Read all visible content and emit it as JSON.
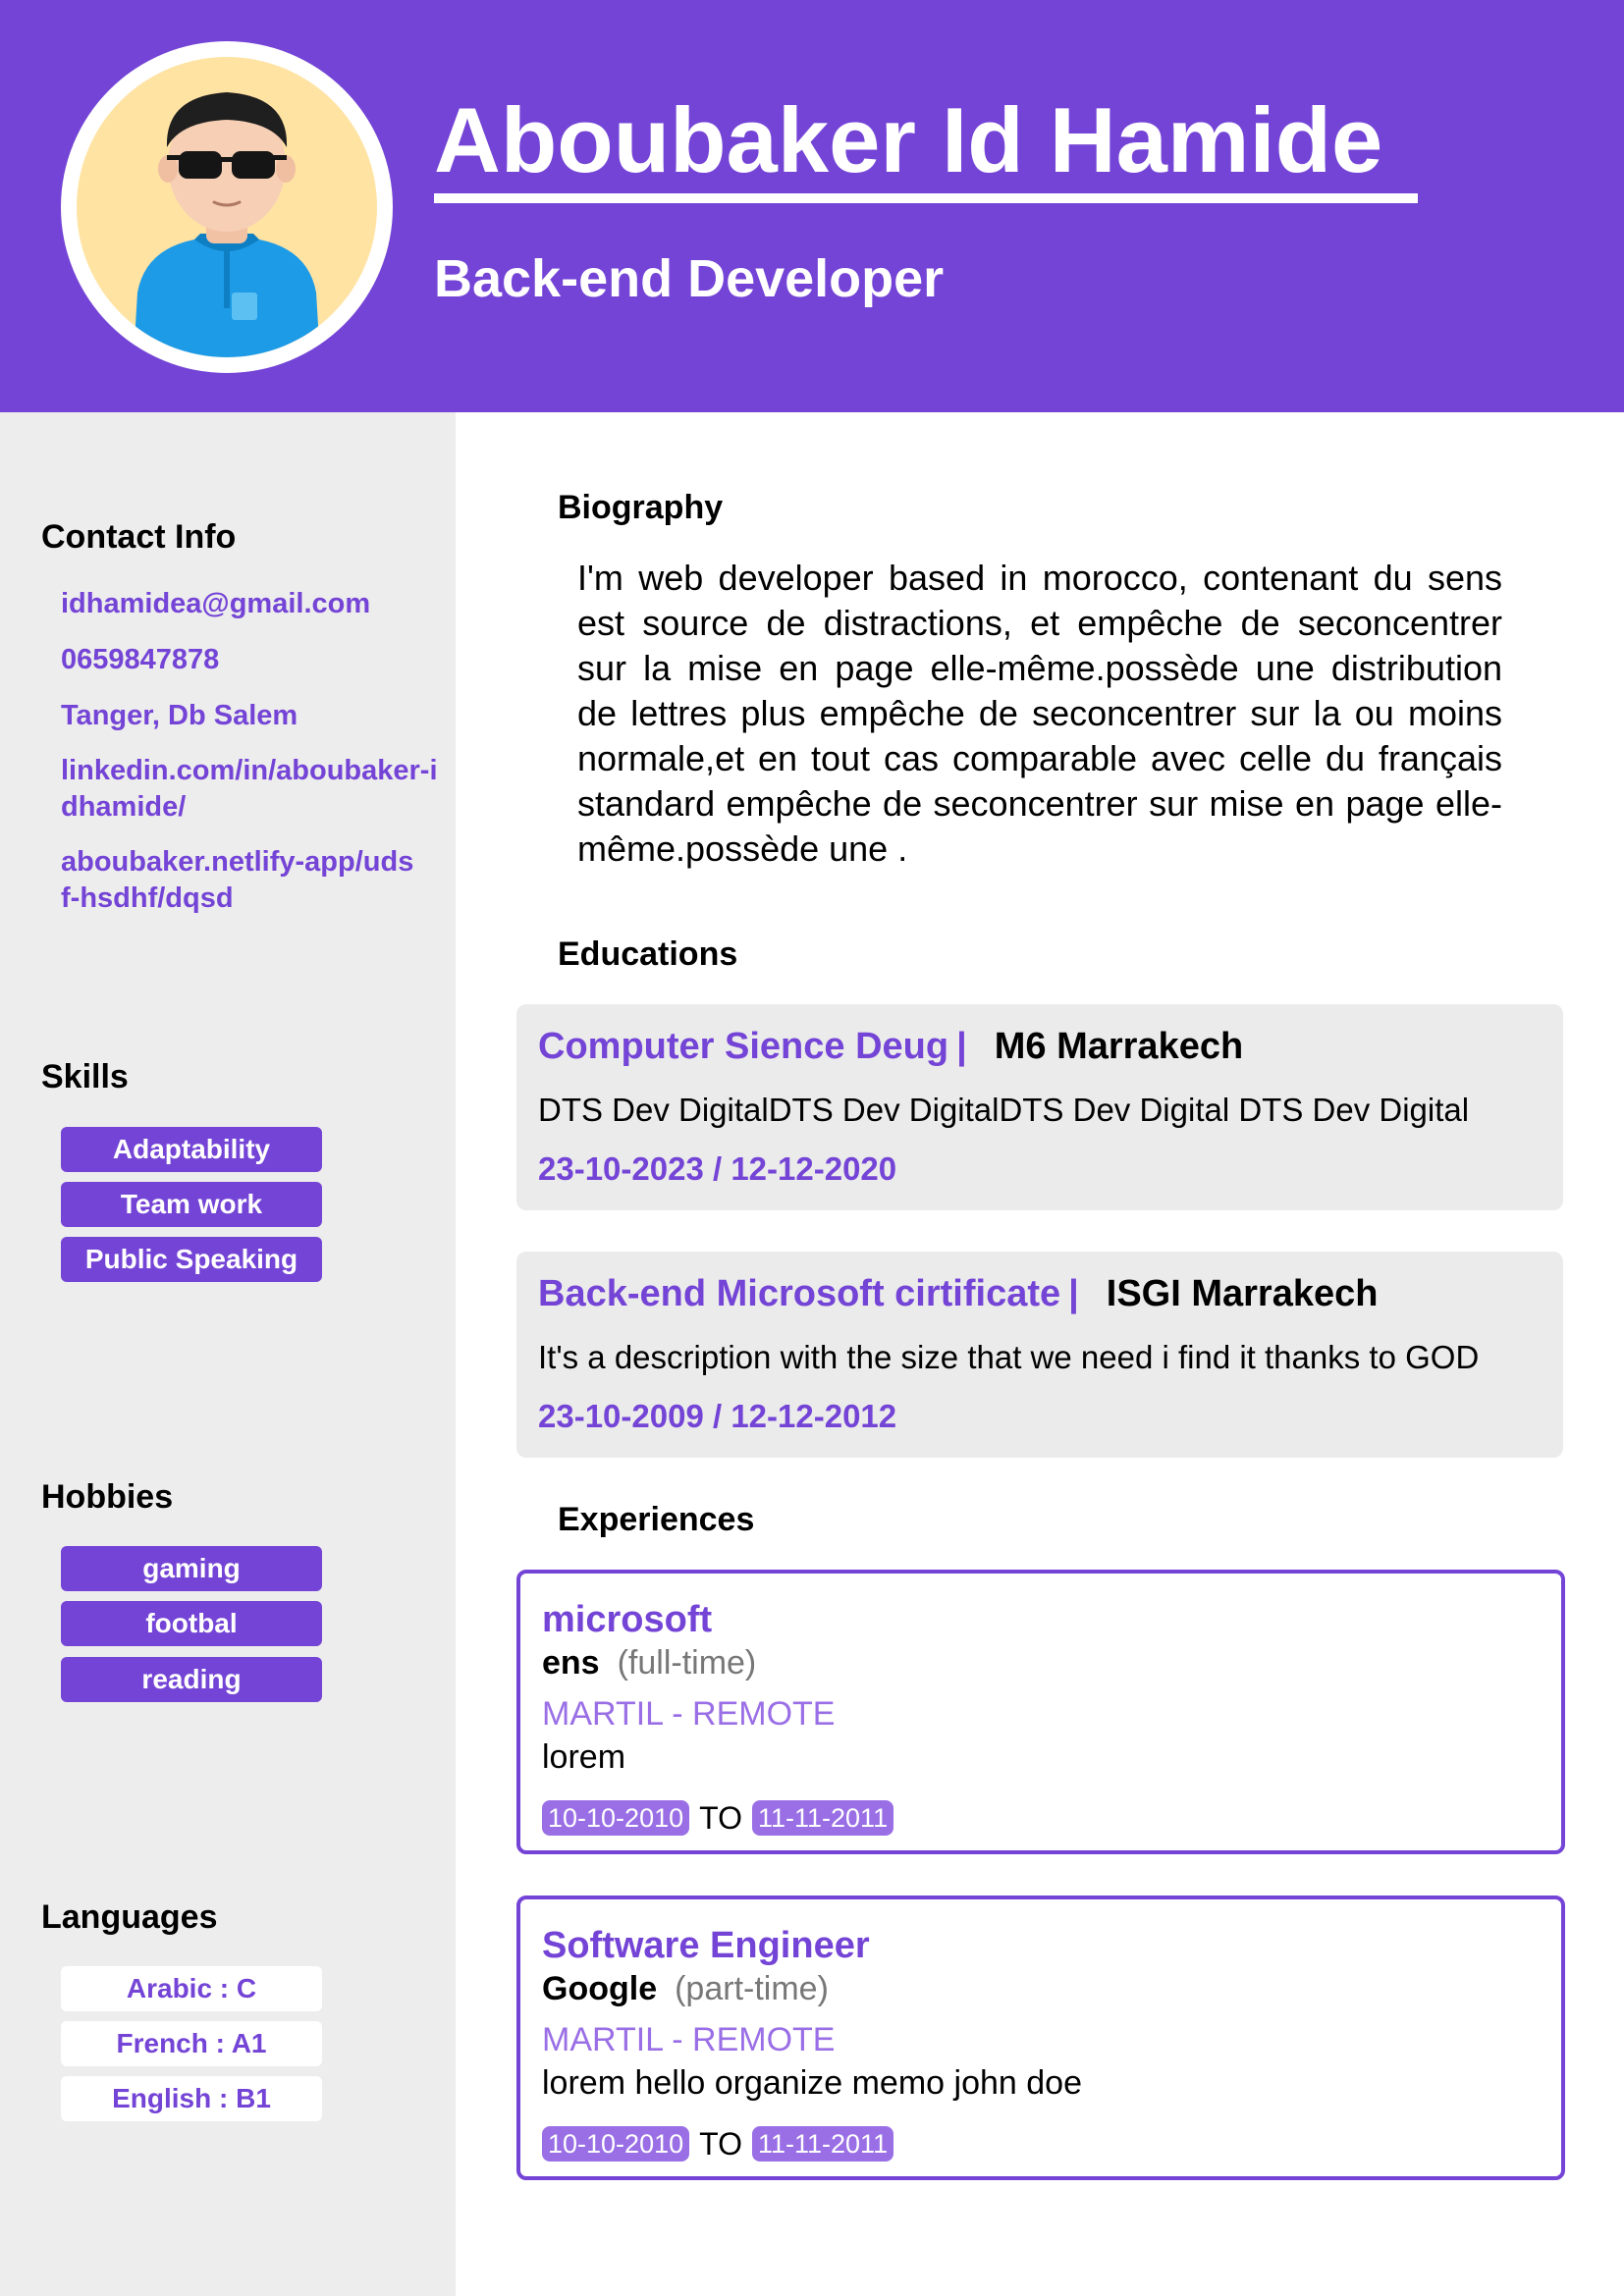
{
  "header": {
    "name": "Aboubaker Id Hamide",
    "job_title": "Back-end Developer",
    "avatar_icon": "avatar-3d-man-sunglasses-icon"
  },
  "sidebar": {
    "contact": {
      "heading": "Contact Info",
      "email": "idhamidea@gmail.com",
      "phone": "0659847878",
      "address": "Tanger, Db Salem",
      "linkedin": "linkedin.com/in/aboubaker-idhamide/",
      "website": "aboubaker.netlify-app/udsf-hsdhf/dqsd"
    },
    "skills": {
      "heading": "Skills",
      "items": [
        "Adaptability",
        "Team work",
        "Public Speaking"
      ]
    },
    "hobbies": {
      "heading": "Hobbies",
      "items": [
        "gaming",
        "footbal",
        "reading"
      ]
    },
    "languages": {
      "heading": "Languages",
      "items": [
        "Arabic : C",
        "French : A1",
        "English : B1"
      ]
    }
  },
  "main": {
    "biography": {
      "heading": "Biography",
      "text": "I'm web developer based in morocco, contenant du sens est source de distractions, et empêche de seconcentrer sur la mise en page elle-même.possède une distribution de lettres plus empêche de seconcentrer sur la ou moins normale,et en tout cas comparable avec celle du français standard empêche de seconcentrer sur mise en page elle-même.possède une ."
    },
    "educations": {
      "heading": "Educations",
      "items": [
        {
          "title": "Computer Sience Deug",
          "separator": "|",
          "school": "M6 Marrakech",
          "description": "DTS Dev DigitalDTS Dev DigitalDTS Dev Digital DTS Dev Digital",
          "start": "23-10-2023",
          "date_sep": "/",
          "end": "12-12-2020"
        },
        {
          "title": "Back-end Microsoft cirtificate",
          "separator": "|",
          "school": "ISGI Marrakech",
          "description": "It's a description with the size that we need i find it thanks to GOD",
          "start": "23-10-2009",
          "date_sep": "/",
          "end": "12-12-2012"
        }
      ]
    },
    "experiences": {
      "heading": "Experiences",
      "to_label": "TO",
      "items": [
        {
          "title": "microsoft",
          "company": "ens",
          "type": "(full-time)",
          "location": "MARTIL - REMOTE",
          "description": "lorem",
          "start": "10-10-2010",
          "end": "11-11-2011"
        },
        {
          "title": "Software Engineer",
          "company": "Google",
          "type": "(part-time)",
          "location": "MARTIL - REMOTE",
          "description": "lorem hello organize memo john doe",
          "start": "10-10-2010",
          "end": "11-11-2011"
        }
      ]
    }
  },
  "colors": {
    "accent": "#7444d6",
    "accent_light": "#9a6fe6",
    "sidebar_bg": "#ededed",
    "card_bg": "#ebebeb"
  }
}
